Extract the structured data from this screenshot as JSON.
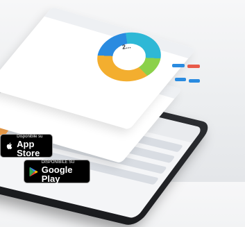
{
  "app_badges": {
    "app_store": {
      "small": "Disponibile su",
      "big": "App Store"
    },
    "google_play": {
      "small": "DISPONIBILE SU",
      "big": "Google Play"
    }
  },
  "donut": {
    "value_text": "2..."
  },
  "colors": {
    "accent_orange": "#f3ae2f",
    "accent_blue": "#2a8be0",
    "accent_cyan": "#2eb8d6",
    "accent_green": "#8bd14a",
    "badge_bg": "#000000"
  },
  "icons": {
    "app_store": "apple-icon",
    "google_play": "google-play-icon"
  }
}
